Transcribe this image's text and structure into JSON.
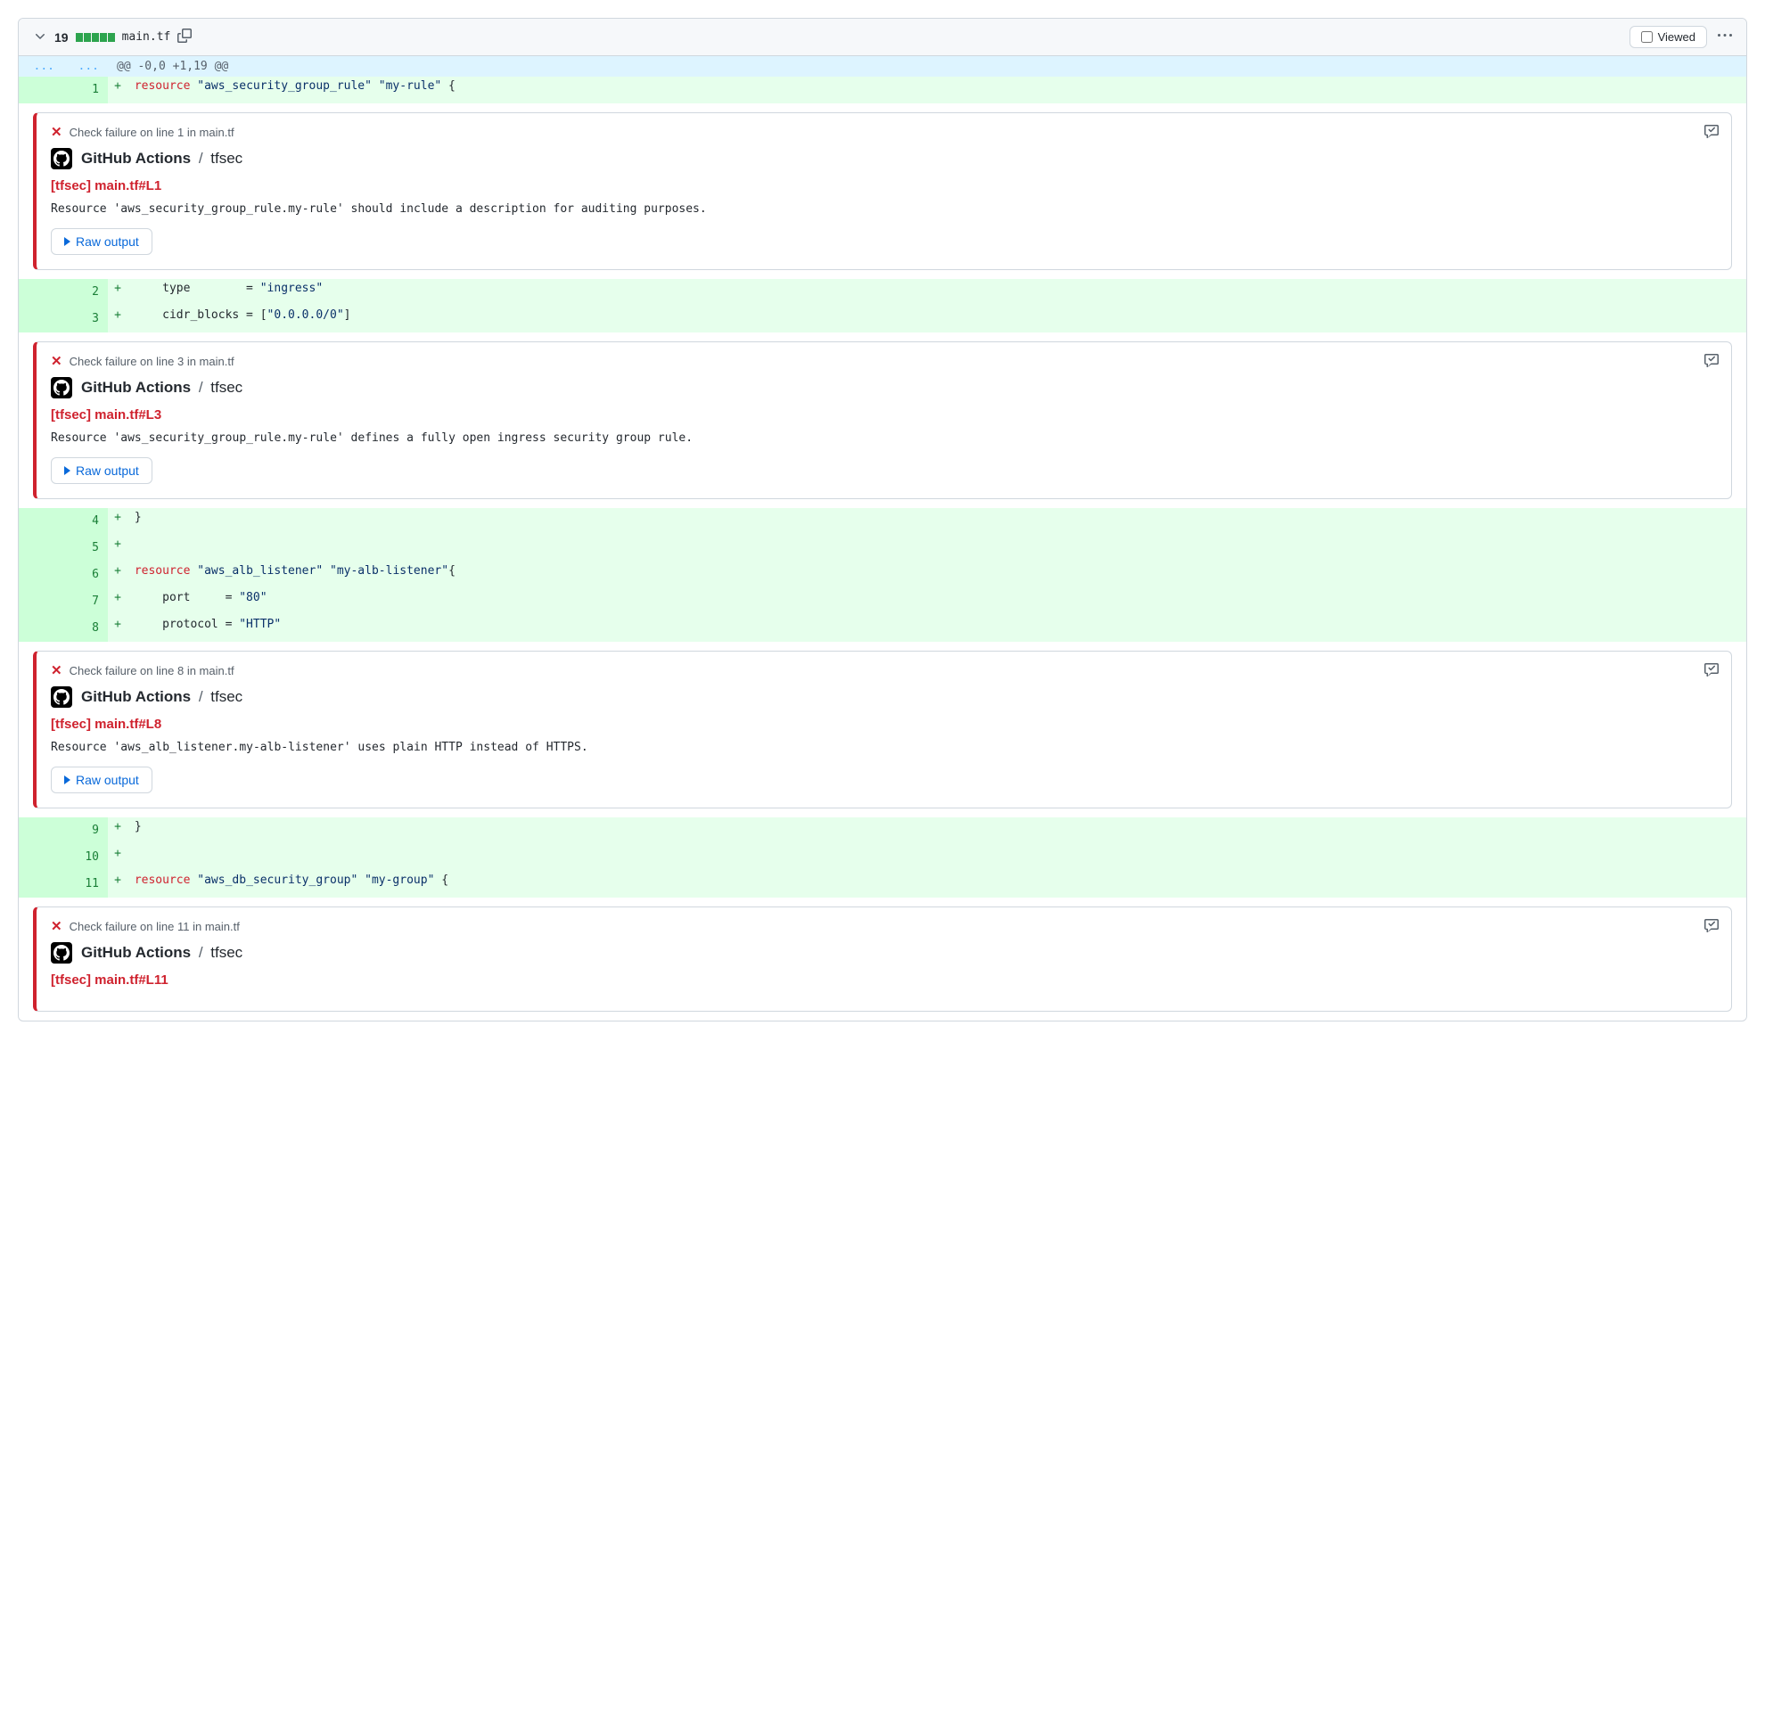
{
  "header": {
    "diff_count": "19",
    "filename": "main.tf",
    "viewed_label": "Viewed"
  },
  "hunk": "@@ -0,0 +1,19 @@",
  "raw_output_label": "Raw output",
  "annotation_source": {
    "app": "GitHub Actions",
    "sep": "/",
    "check": "tfsec"
  },
  "rows": [
    {
      "kind": "code",
      "old": "",
      "new": "1",
      "marker": "+",
      "tokens": [
        {
          "t": " ",
          "c": null
        },
        {
          "t": "resource",
          "c": "keyword"
        },
        {
          "t": " ",
          "c": null
        },
        {
          "t": "\"aws_security_group_rule\"",
          "c": "string"
        },
        {
          "t": " ",
          "c": null
        },
        {
          "t": "\"my-rule\"",
          "c": "string"
        },
        {
          "t": " {",
          "c": null
        }
      ]
    },
    {
      "kind": "ann",
      "line_text": "Check failure on line 1 in main.tf",
      "link": "[tfsec] main.tf#L1",
      "msg": "Resource 'aws_security_group_rule.my-rule' should include a description for auditing purposes."
    },
    {
      "kind": "code",
      "old": "",
      "new": "2",
      "marker": "+",
      "tokens": [
        {
          "t": "     type        = ",
          "c": null
        },
        {
          "t": "\"ingress\"",
          "c": "string"
        }
      ]
    },
    {
      "kind": "code",
      "old": "",
      "new": "3",
      "marker": "+",
      "tokens": [
        {
          "t": "     cidr_blocks = [",
          "c": null
        },
        {
          "t": "\"0.0.0.0/0\"",
          "c": "string"
        },
        {
          "t": "]",
          "c": null
        }
      ]
    },
    {
      "kind": "ann",
      "line_text": "Check failure on line 3 in main.tf",
      "link": "[tfsec] main.tf#L3",
      "msg": "Resource 'aws_security_group_rule.my-rule' defines a fully open ingress security group rule."
    },
    {
      "kind": "code",
      "old": "",
      "new": "4",
      "marker": "+",
      "tokens": [
        {
          "t": " }",
          "c": null
        }
      ]
    },
    {
      "kind": "code",
      "old": "",
      "new": "5",
      "marker": "+",
      "tokens": [
        {
          "t": "",
          "c": null
        }
      ]
    },
    {
      "kind": "code",
      "old": "",
      "new": "6",
      "marker": "+",
      "tokens": [
        {
          "t": " ",
          "c": null
        },
        {
          "t": "resource",
          "c": "keyword"
        },
        {
          "t": " ",
          "c": null
        },
        {
          "t": "\"aws_alb_listener\"",
          "c": "string"
        },
        {
          "t": " ",
          "c": null
        },
        {
          "t": "\"my-alb-listener\"",
          "c": "string"
        },
        {
          "t": "{",
          "c": null
        }
      ]
    },
    {
      "kind": "code",
      "old": "",
      "new": "7",
      "marker": "+",
      "tokens": [
        {
          "t": "     port     = ",
          "c": null
        },
        {
          "t": "\"80\"",
          "c": "string"
        }
      ]
    },
    {
      "kind": "code",
      "old": "",
      "new": "8",
      "marker": "+",
      "tokens": [
        {
          "t": "     protocol = ",
          "c": null
        },
        {
          "t": "\"HTTP\"",
          "c": "string"
        }
      ]
    },
    {
      "kind": "ann",
      "line_text": "Check failure on line 8 in main.tf",
      "link": "[tfsec] main.tf#L8",
      "msg": "Resource 'aws_alb_listener.my-alb-listener' uses plain HTTP instead of HTTPS."
    },
    {
      "kind": "code",
      "old": "",
      "new": "9",
      "marker": "+",
      "tokens": [
        {
          "t": " }",
          "c": null
        }
      ]
    },
    {
      "kind": "code",
      "old": "",
      "new": "10",
      "marker": "+",
      "tokens": [
        {
          "t": "",
          "c": null
        }
      ]
    },
    {
      "kind": "code",
      "old": "",
      "new": "11",
      "marker": "+",
      "tokens": [
        {
          "t": " ",
          "c": null
        },
        {
          "t": "resource",
          "c": "keyword"
        },
        {
          "t": " ",
          "c": null
        },
        {
          "t": "\"aws_db_security_group\"",
          "c": "string"
        },
        {
          "t": " ",
          "c": null
        },
        {
          "t": "\"my-group\"",
          "c": "string"
        },
        {
          "t": " {",
          "c": null
        }
      ]
    },
    {
      "kind": "ann",
      "line_text": "Check failure on line 11 in main.tf",
      "link": "[tfsec] main.tf#L11",
      "msg": "",
      "truncated": true
    }
  ]
}
